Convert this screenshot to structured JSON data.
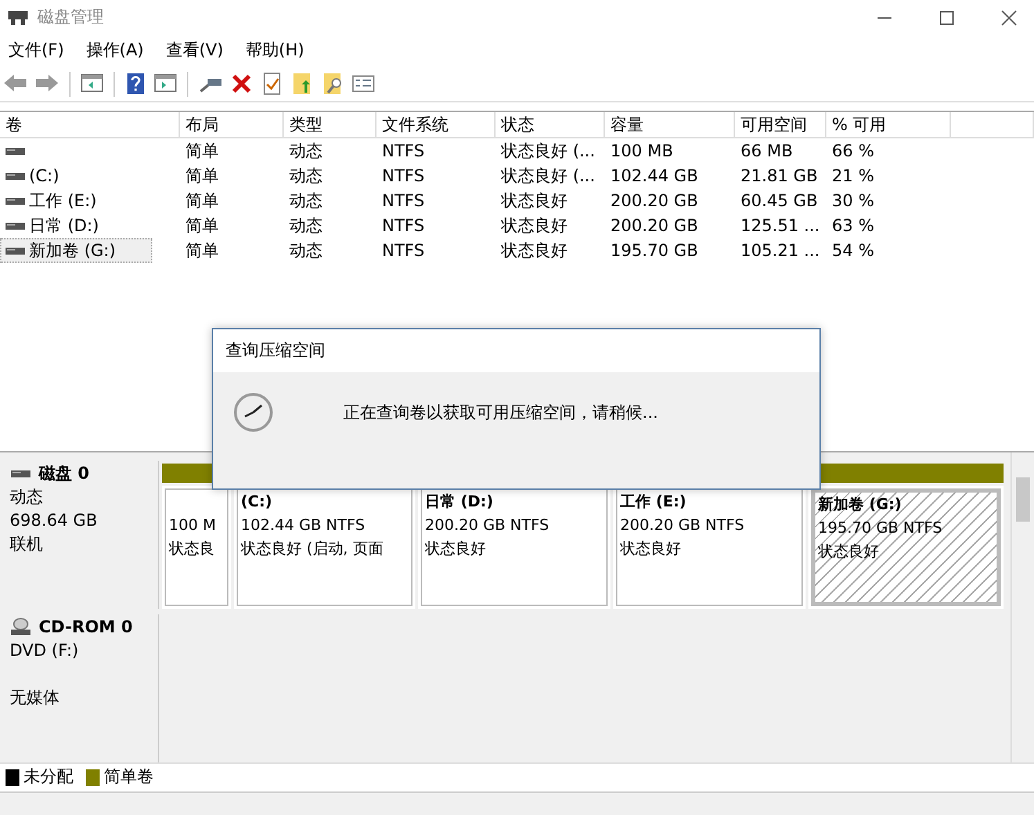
{
  "window": {
    "title": "磁盘管理"
  },
  "menu": [
    "文件(F)",
    "操作(A)",
    "查看(V)",
    "帮助(H)"
  ],
  "table": {
    "columns": [
      "卷",
      "布局",
      "类型",
      "文件系统",
      "状态",
      "容量",
      "可用空间",
      "% 可用"
    ],
    "rows": [
      {
        "cells": [
          "",
          "简单",
          "动态",
          "NTFS",
          "状态良好 (...",
          "100 MB",
          "66 MB",
          "66 %"
        ],
        "selected": false
      },
      {
        "cells": [
          " (C:)",
          "简单",
          "动态",
          "NTFS",
          "状态良好 (...",
          "102.44 GB",
          "21.81 GB",
          "21 %"
        ],
        "selected": false
      },
      {
        "cells": [
          "工作 (E:)",
          "简单",
          "动态",
          "NTFS",
          "状态良好",
          "200.20 GB",
          "60.45 GB",
          "30 %"
        ],
        "selected": false
      },
      {
        "cells": [
          "日常 (D:)",
          "简单",
          "动态",
          "NTFS",
          "状态良好",
          "200.20 GB",
          "125.51 ...",
          "63 %"
        ],
        "selected": false
      },
      {
        "cells": [
          "新加卷 (G:)",
          "简单",
          "动态",
          "NTFS",
          "状态良好",
          "195.70 GB",
          "105.21 ...",
          "54 %"
        ],
        "selected": true
      }
    ]
  },
  "dialog": {
    "title": "查询压缩空间",
    "message": "正在查询卷以获取可用压缩空间，请稍候..."
  },
  "disks": [
    {
      "kind": "disk",
      "name": "磁盘 0",
      "type": "动态",
      "size": "698.64 GB",
      "status": "联机",
      "partitions": [
        {
          "size": "100 M",
          "status": "状态良",
          "selected": false
        },
        {
          "title": "(C:)",
          "size": "102.44 GB NTFS",
          "status": "状态良好 (启动, 页面",
          "selected": false
        },
        {
          "title": "日常 (D:)",
          "size": "200.20 GB NTFS",
          "status": "状态良好",
          "selected": false
        },
        {
          "title": "工作 (E:)",
          "size": "200.20 GB NTFS",
          "status": "状态良好",
          "selected": false
        },
        {
          "title": "新加卷 (G:)",
          "size": "195.70 GB NTFS",
          "status": "状态良好",
          "selected": true
        }
      ]
    },
    {
      "kind": "cdrom",
      "name": "CD-ROM 0",
      "type": "DVD (F:)",
      "status": "无媒体"
    }
  ],
  "legend": [
    {
      "label": "未分配",
      "color": "#000000"
    },
    {
      "label": "简单卷",
      "color": "#808000"
    }
  ]
}
